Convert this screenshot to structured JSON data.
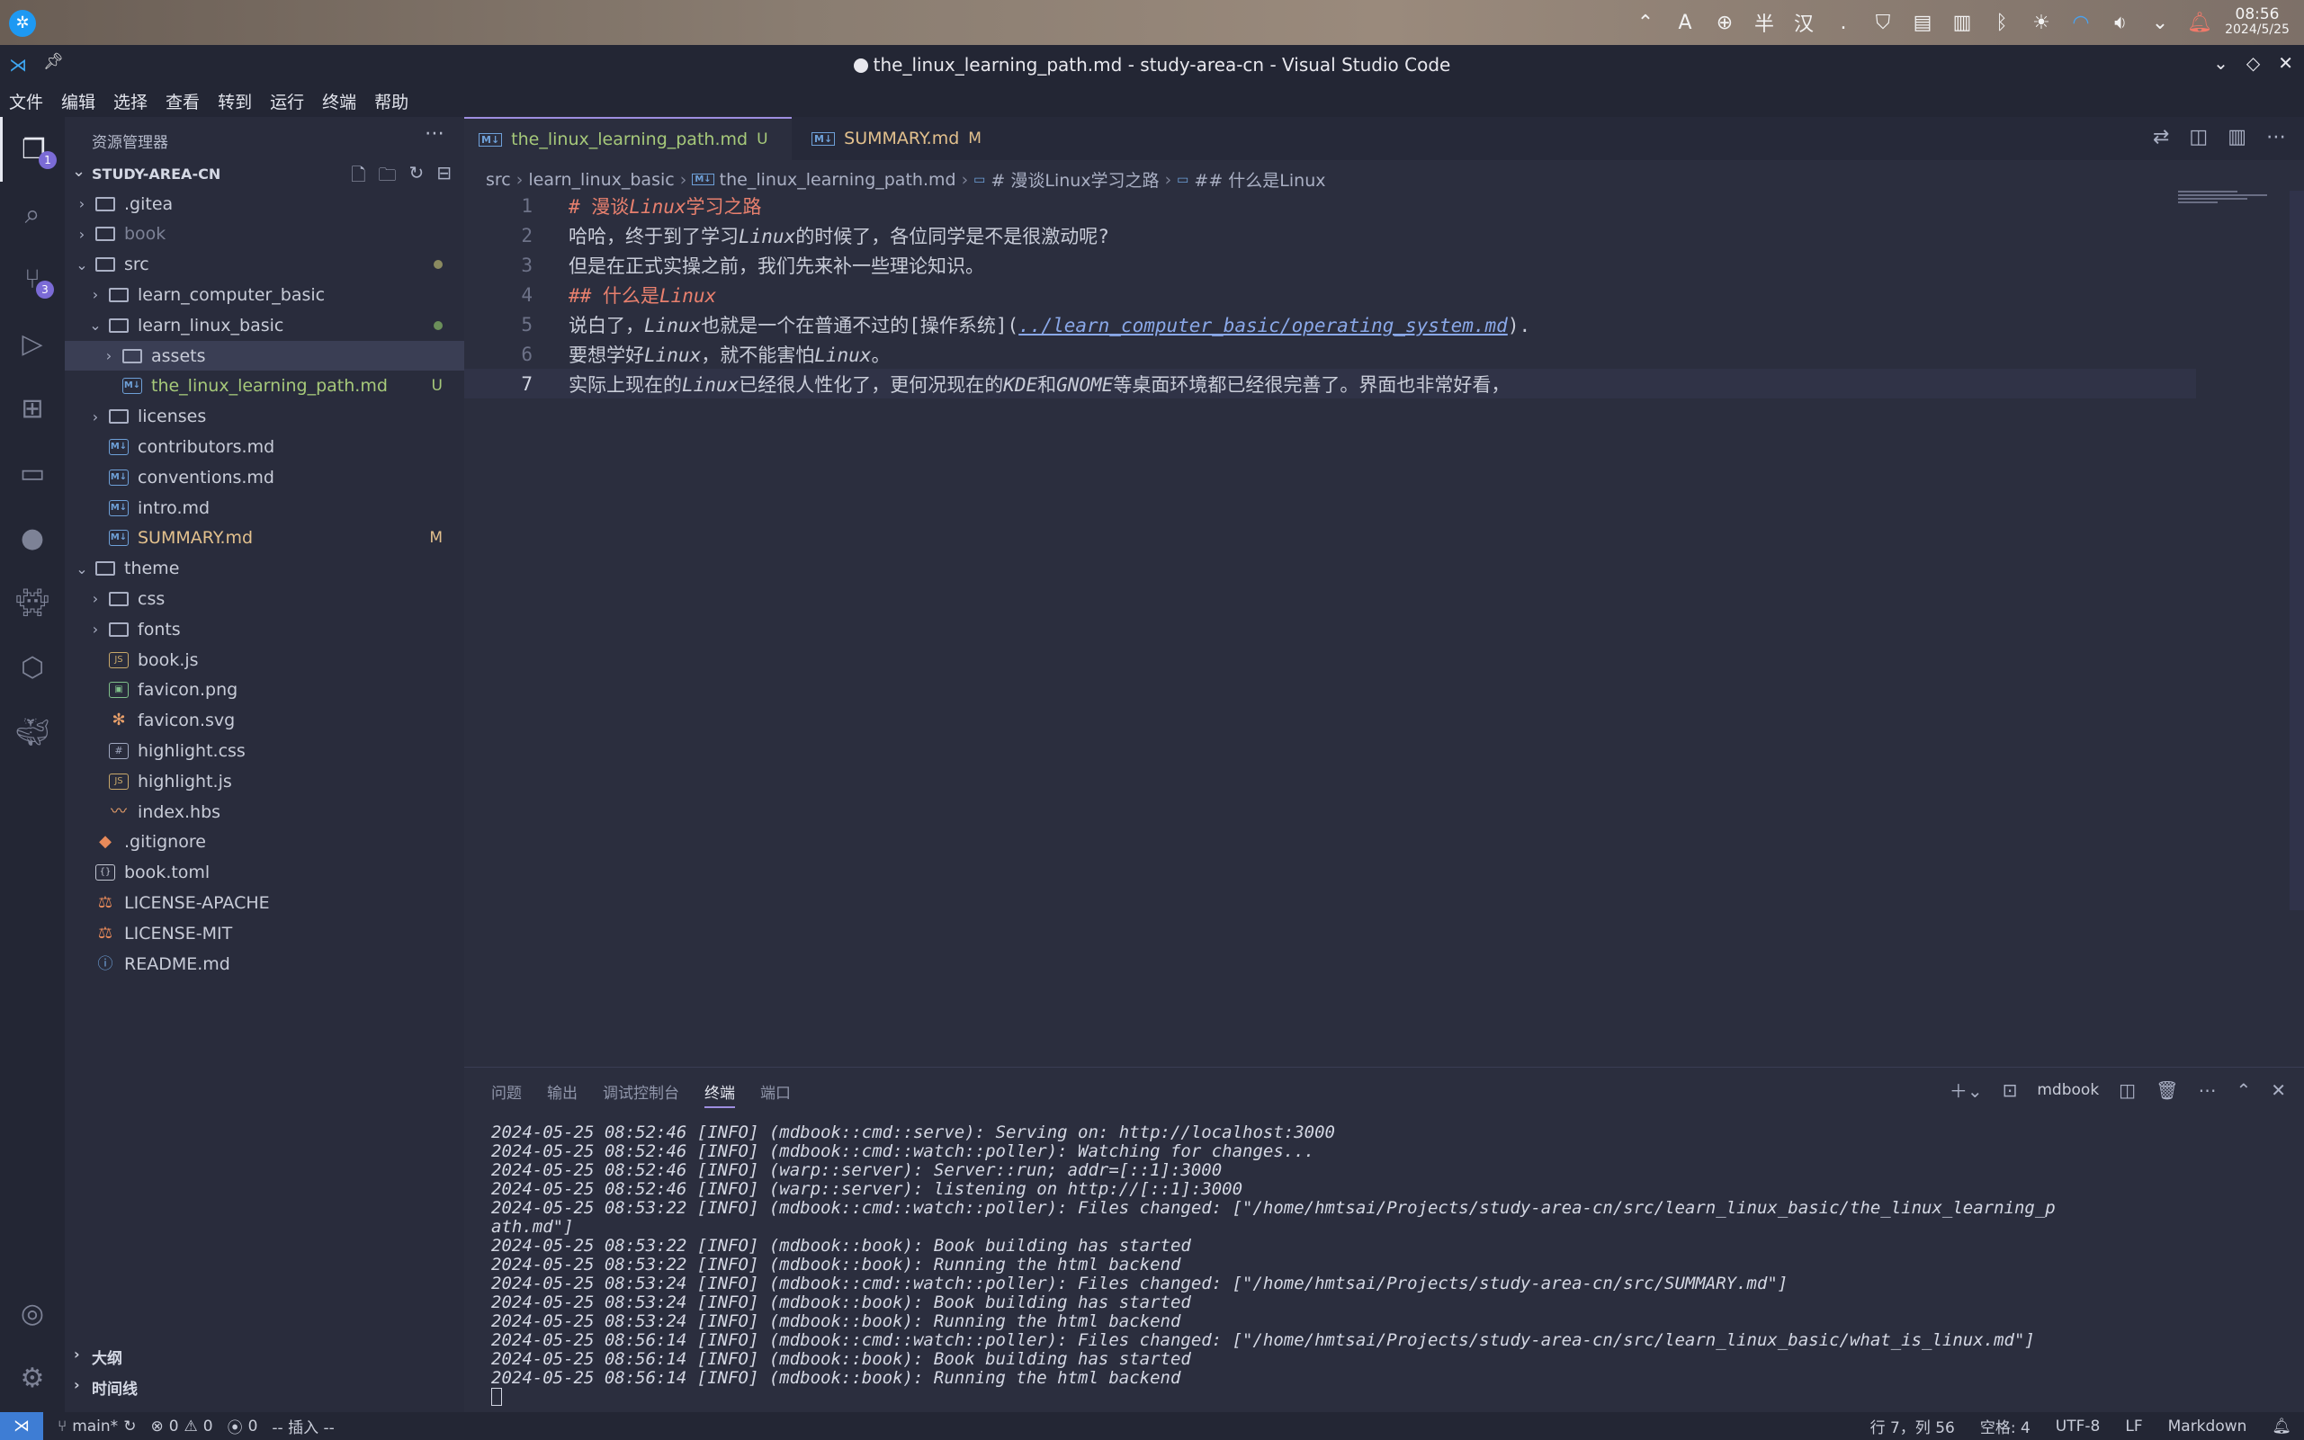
{
  "system_panel": {
    "tray_icons": [
      "chevron-up-icon",
      "font-icon",
      "globe-icon",
      "shield-icon",
      "notes-icon",
      "clipboard-icon",
      "bluetooth-icon",
      "brightness-icon",
      "wifi-icon",
      "volume-icon",
      "chevron-down-icon",
      "notification-icon"
    ],
    "ime_font": "A",
    "ime_half": "半",
    "ime_han": "汉",
    "ime_punct": ".",
    "time": "08:56",
    "date": "2024/5/25"
  },
  "window": {
    "title": "the_linux_learning_path.md - study-area-cn - Visual Studio Code"
  },
  "menu": [
    "文件",
    "编辑",
    "选择",
    "查看",
    "转到",
    "运行",
    "终端",
    "帮助"
  ],
  "activity_bar": {
    "explorer_badge": "1",
    "scm_badge": "3"
  },
  "sidebar": {
    "title": "资源管理器",
    "workspace": "STUDY-AREA-CN",
    "tree": [
      {
        "label": ".gitea",
        "type": "folder",
        "chev": "›",
        "indent": 1,
        "style": "",
        "status": ""
      },
      {
        "label": "book",
        "type": "folder",
        "chev": "›",
        "indent": 1,
        "style": "dim",
        "status": ""
      },
      {
        "label": "src",
        "type": "folder",
        "chev": "⌄",
        "indent": 1,
        "style": "",
        "status": "dot"
      },
      {
        "label": "learn_computer_basic",
        "type": "folder",
        "chev": "›",
        "indent": 2,
        "style": "",
        "status": ""
      },
      {
        "label": "learn_linux_basic",
        "type": "folder",
        "chev": "⌄",
        "indent": 2,
        "style": "",
        "status": "dotg"
      },
      {
        "label": "assets",
        "type": "folder",
        "chev": "›",
        "indent": 3,
        "style": "",
        "status": ""
      },
      {
        "label": "the_linux_learning_path.md",
        "type": "md",
        "chev": "",
        "indent": 3,
        "style": "green",
        "status": "U"
      },
      {
        "label": "licenses",
        "type": "folder",
        "chev": "›",
        "indent": 2,
        "style": "",
        "status": ""
      },
      {
        "label": "contributors.md",
        "type": "md",
        "chev": "",
        "indent": 2,
        "style": "",
        "status": ""
      },
      {
        "label": "conventions.md",
        "type": "md",
        "chev": "",
        "indent": 2,
        "style": "",
        "status": ""
      },
      {
        "label": "intro.md",
        "type": "md",
        "chev": "",
        "indent": 2,
        "style": "",
        "status": ""
      },
      {
        "label": "SUMMARY.md",
        "type": "md",
        "chev": "",
        "indent": 2,
        "style": "yellow",
        "status": "M"
      },
      {
        "label": "theme",
        "type": "folder",
        "chev": "⌄",
        "indent": 1,
        "style": "",
        "status": ""
      },
      {
        "label": "css",
        "type": "folder",
        "chev": "›",
        "indent": 2,
        "style": "",
        "status": ""
      },
      {
        "label": "fonts",
        "type": "folder",
        "chev": "›",
        "indent": 2,
        "style": "",
        "status": ""
      },
      {
        "label": "book.js",
        "type": "js",
        "chev": "",
        "indent": 2,
        "style": "",
        "status": ""
      },
      {
        "label": "favicon.png",
        "type": "img",
        "chev": "",
        "indent": 2,
        "style": "",
        "status": ""
      },
      {
        "label": "favicon.svg",
        "type": "svg",
        "chev": "",
        "indent": 2,
        "style": "",
        "status": ""
      },
      {
        "label": "highlight.css",
        "type": "css",
        "chev": "",
        "indent": 2,
        "style": "",
        "status": ""
      },
      {
        "label": "highlight.js",
        "type": "js",
        "chev": "",
        "indent": 2,
        "style": "",
        "status": ""
      },
      {
        "label": "index.hbs",
        "type": "hbs",
        "chev": "",
        "indent": 2,
        "style": "",
        "status": ""
      },
      {
        "label": ".gitignore",
        "type": "git",
        "chev": "",
        "indent": 1,
        "style": "",
        "status": ""
      },
      {
        "label": "book.toml",
        "type": "toml",
        "chev": "",
        "indent": 1,
        "style": "",
        "status": ""
      },
      {
        "label": "LICENSE-APACHE",
        "type": "lic",
        "chev": "",
        "indent": 1,
        "style": "",
        "status": ""
      },
      {
        "label": "LICENSE-MIT",
        "type": "lic",
        "chev": "",
        "indent": 1,
        "style": "",
        "status": ""
      },
      {
        "label": "README.md",
        "type": "info",
        "chev": "",
        "indent": 1,
        "style": "",
        "status": ""
      }
    ],
    "outline_label": "大纲",
    "timeline_label": "时间线"
  },
  "tabs": [
    {
      "name": "the_linux_learning_path.md",
      "status": "U",
      "modified": true
    },
    {
      "name": "SUMMARY.md",
      "status": "M",
      "modified": false
    }
  ],
  "breadcrumb": [
    "src",
    "learn_linux_basic",
    "the_linux_learning_path.md",
    "# 漫谈Linux学习之路",
    "## 什么是Linux"
  ],
  "code_lines": [
    [
      {
        "t": "# 漫谈",
        "c": "c-h"
      },
      {
        "t": "Linux",
        "c": "c-h c-it"
      },
      {
        "t": "学习之路",
        "c": "c-h"
      }
    ],
    [
      {
        "t": "哈哈，终于到了学习",
        "c": "c-n"
      },
      {
        "t": "Linux",
        "c": "c-n c-it"
      },
      {
        "t": "的时候了，各位同学是不是很激动呢?",
        "c": "c-n"
      }
    ],
    [
      {
        "t": "但是在正式实操之前，我们先来补一些理论知识。",
        "c": "c-n"
      }
    ],
    [
      {
        "t": "## 什么是",
        "c": "c-h"
      },
      {
        "t": "Linux",
        "c": "c-h c-it"
      }
    ],
    [
      {
        "t": "说白了，",
        "c": "c-n"
      },
      {
        "t": "Linux",
        "c": "c-n c-it"
      },
      {
        "t": "也就是一个在普通不过的[操作系统](",
        "c": "c-n"
      },
      {
        "t": "../learn_computer_basic/operating_system.md",
        "c": "c-link"
      },
      {
        "t": ").",
        "c": "c-punc"
      }
    ],
    [
      {
        "t": "要想学好",
        "c": "c-n"
      },
      {
        "t": "Linux",
        "c": "c-n c-it"
      },
      {
        "t": "，就不能害怕",
        "c": "c-n"
      },
      {
        "t": "Linux",
        "c": "c-n c-it"
      },
      {
        "t": "。",
        "c": "c-n"
      }
    ],
    [
      {
        "t": "实际上现在的",
        "c": "c-n"
      },
      {
        "t": "Linux",
        "c": "c-n c-it"
      },
      {
        "t": "已经很人性化了，更何况现在的",
        "c": "c-n"
      },
      {
        "t": "KDE",
        "c": "c-n c-it"
      },
      {
        "t": "和",
        "c": "c-n"
      },
      {
        "t": "GNOME",
        "c": "c-n c-it"
      },
      {
        "t": "等桌面环境都已经很完善了。界面也非常好看，",
        "c": "c-n"
      }
    ]
  ],
  "panel": {
    "tabs": [
      "问题",
      "输出",
      "调试控制台",
      "终端",
      "端口"
    ],
    "active_tab": "终端",
    "terminal_name": "mdbook",
    "lines": [
      "2024-05-25 08:52:46 [INFO] (mdbook::cmd::serve): Serving on: http://localhost:3000",
      "2024-05-25 08:52:46 [INFO] (mdbook::cmd::watch::poller): Watching for changes...",
      "2024-05-25 08:52:46 [INFO] (warp::server): Server::run; addr=[::1]:3000",
      "2024-05-25 08:52:46 [INFO] (warp::server): listening on http://[::1]:3000",
      "2024-05-25 08:53:22 [INFO] (mdbook::cmd::watch::poller): Files changed: [\"/home/hmtsai/Projects/study-area-cn/src/learn_linux_basic/the_linux_learning_p",
      "ath.md\"]",
      "2024-05-25 08:53:22 [INFO] (mdbook::book): Book building has started",
      "2024-05-25 08:53:22 [INFO] (mdbook::book): Running the html backend",
      "2024-05-25 08:53:24 [INFO] (mdbook::cmd::watch::poller): Files changed: [\"/home/hmtsai/Projects/study-area-cn/src/SUMMARY.md\"]",
      "2024-05-25 08:53:24 [INFO] (mdbook::book): Book building has started",
      "2024-05-25 08:53:24 [INFO] (mdbook::book): Running the html backend",
      "2024-05-25 08:56:14 [INFO] (mdbook::cmd::watch::poller): Files changed: [\"/home/hmtsai/Projects/study-area-cn/src/learn_linux_basic/what_is_linux.md\"]",
      "2024-05-25 08:56:14 [INFO] (mdbook::book): Book building has started",
      "2024-05-25 08:56:14 [INFO] (mdbook::book): Running the html backend"
    ]
  },
  "statusbar": {
    "branch": "main*",
    "errors": "0",
    "warnings": "0",
    "ports": "0",
    "mode": "-- 插入 --",
    "position": "行 7，列 56",
    "spaces": "空格: 4",
    "encoding": "UTF-8",
    "eol": "LF",
    "language": "Markdown"
  }
}
